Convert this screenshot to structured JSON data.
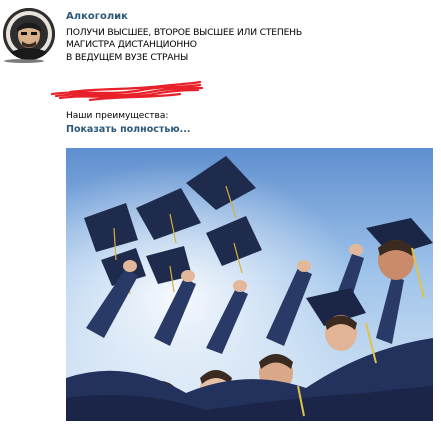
{
  "post": {
    "author": "Алкоголик",
    "lines": [
      "ПОЛУЧИ ВЫСШЕЕ, ВТОРОЕ ВЫСШЕЕ ИЛИ СТЕПЕНЬ",
      "МАГИСТРА ДИСТАНЦИОННО",
      "В ВЕДУЩЕМ ВУЗЕ СТРАНЫ"
    ],
    "subtext": "Наши преимущества:",
    "show_more": "Показать полностью..."
  },
  "colors": {
    "link": "#2b587a",
    "scribble": "#e8202a"
  },
  "icons": {
    "avatar": "person-avatar",
    "scribble": "red-scribble-redaction"
  }
}
